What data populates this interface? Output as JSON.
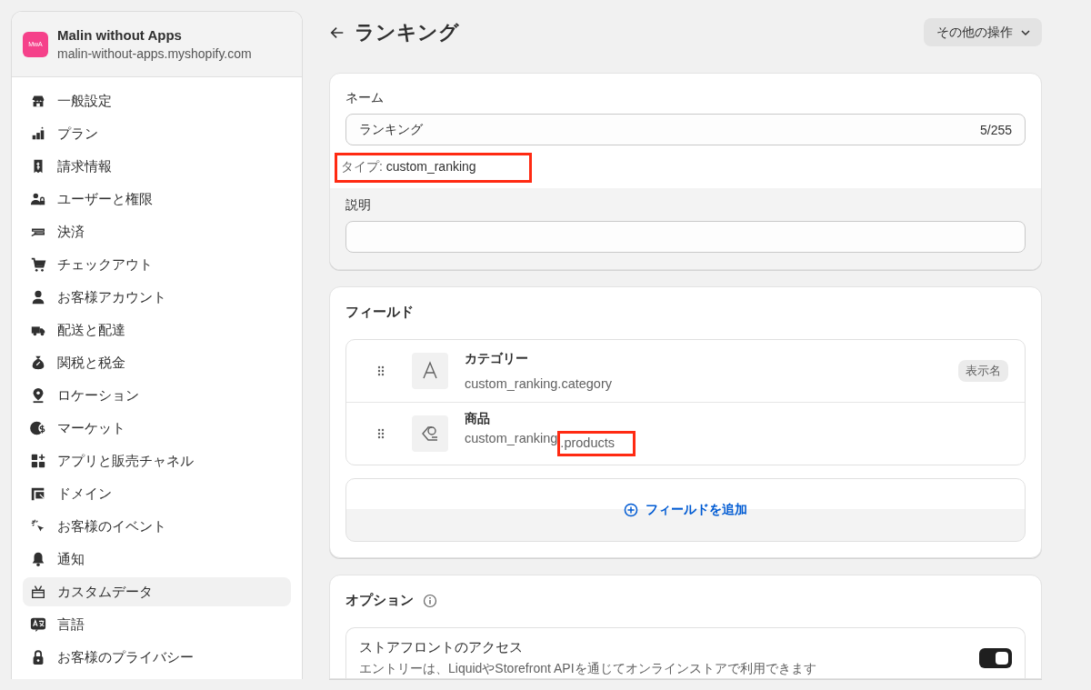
{
  "store": {
    "avatar": "MwA",
    "name": "Malin without Apps",
    "domain": "malin-without-apps.myshopify.com"
  },
  "sidebar": {
    "items": [
      {
        "label": "一般設定",
        "selected": false
      },
      {
        "label": "プラン",
        "selected": false
      },
      {
        "label": "請求情報",
        "selected": false
      },
      {
        "label": "ユーザーと権限",
        "selected": false
      },
      {
        "label": "決済",
        "selected": false
      },
      {
        "label": "チェックアウト",
        "selected": false
      },
      {
        "label": "お客様アカウント",
        "selected": false
      },
      {
        "label": "配送と配達",
        "selected": false
      },
      {
        "label": "関税と税金",
        "selected": false
      },
      {
        "label": "ロケーション",
        "selected": false
      },
      {
        "label": "マーケット",
        "selected": false
      },
      {
        "label": "アプリと販売チャネル",
        "selected": false
      },
      {
        "label": "ドメイン",
        "selected": false
      },
      {
        "label": "お客様のイベント",
        "selected": false
      },
      {
        "label": "通知",
        "selected": false
      },
      {
        "label": "カスタムデータ",
        "selected": true
      },
      {
        "label": "言語",
        "selected": false
      },
      {
        "label": "お客様のプライバシー",
        "selected": false
      }
    ]
  },
  "page": {
    "title": "ランキング",
    "more_actions": "その他の操作"
  },
  "definition": {
    "name_label": "ネーム",
    "name_value": "ランキング",
    "name_count": "5/255",
    "type_label": "タイプ:",
    "type_value": "custom_ranking",
    "type_highlighted": true,
    "description_label": "説明"
  },
  "fields": {
    "title": "フィールド",
    "items": [
      {
        "kind": "text",
        "name": "カテゴリー",
        "key_prefix": "custom_ranking.",
        "key_suffix": "category",
        "badge": "表示名",
        "highlighted": false
      },
      {
        "kind": "reference",
        "name": "商品",
        "key_prefix": "custom_ranking",
        "key_suffix": ".products",
        "highlighted": true
      }
    ],
    "add_button": "フィールドを追加"
  },
  "options": {
    "title": "オプション",
    "items": [
      {
        "title": "ストアフロントのアクセス",
        "description": "エントリーは、LiquidやStorefront APIを通じてオンラインストアで利用できます",
        "on": true
      }
    ]
  }
}
